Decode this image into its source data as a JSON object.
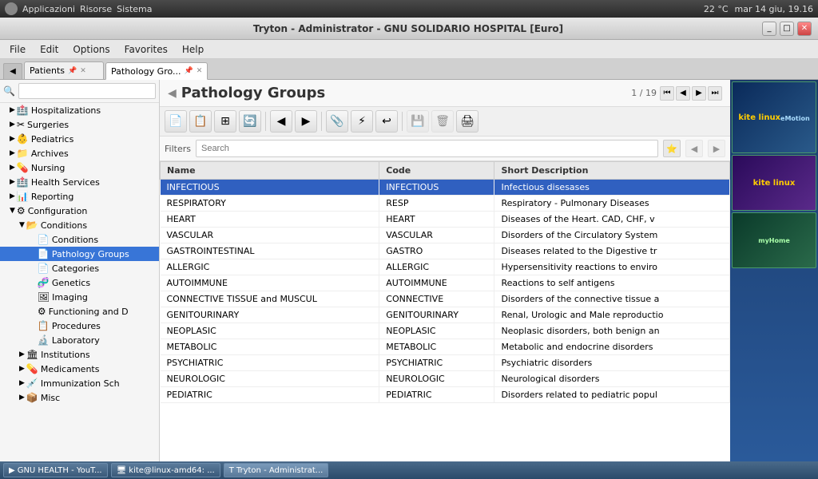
{
  "topbar": {
    "menu_items": [
      "Applicazioni",
      "Risorse",
      "Sistema"
    ],
    "time": "mar 14 giu, 19.16",
    "temp": "22 °C"
  },
  "titlebar": {
    "title": "Tryton - Administrator - GNU SOLIDARIO HOSPITAL [Euro]"
  },
  "menubar": {
    "items": [
      "File",
      "Edit",
      "Options",
      "Favorites",
      "Help"
    ]
  },
  "tabs": [
    {
      "label": "Patients",
      "active": false
    },
    {
      "label": "Pathology Gro...",
      "active": true
    }
  ],
  "page": {
    "title": "Pathology Groups",
    "counter": "1 / 19"
  },
  "filters": {
    "label": "Filters",
    "placeholder": "Search"
  },
  "table": {
    "columns": [
      "Name",
      "Code",
      "Short Description"
    ],
    "rows": [
      {
        "name": "INFECTIOUS",
        "code": "INFECTIOUS",
        "desc": "Infectious disesases",
        "selected": true
      },
      {
        "name": "RESPIRATORY",
        "code": "RESP",
        "desc": "Respiratory - Pulmonary Diseases"
      },
      {
        "name": "HEART",
        "code": "HEART",
        "desc": "Diseases of the Heart. CAD, CHF, v"
      },
      {
        "name": "VASCULAR",
        "code": "VASCULAR",
        "desc": "Disorders of the Circulatory System"
      },
      {
        "name": "GASTROINTESTINAL",
        "code": "GASTRO",
        "desc": "Diseases related to the Digestive tr"
      },
      {
        "name": "ALLERGIC",
        "code": "ALLERGIC",
        "desc": "Hypersensitivity reactions to enviro"
      },
      {
        "name": "AUTOIMMUNE",
        "code": "AUTOIMMUNE",
        "desc": "Reactions to self antigens"
      },
      {
        "name": "CONNECTIVE TISSUE and MUSCUL",
        "code": "CONNECTIVE",
        "desc": "Disorders of the connective tissue a"
      },
      {
        "name": "GENITOURINARY",
        "code": "GENITOURINARY",
        "desc": "Renal, Urologic and Male reproductio"
      },
      {
        "name": "NEOPLASIC",
        "code": "NEOPLASIC",
        "desc": "Neoplasic disorders, both benign an"
      },
      {
        "name": "METABOLIC",
        "code": "METABOLIC",
        "desc": "Metabolic and endocrine disorders"
      },
      {
        "name": "PSYCHIATRIC",
        "code": "PSYCHIATRIC",
        "desc": "Psychiatric disorders"
      },
      {
        "name": "NEUROLOGIC",
        "code": "NEUROLOGIC",
        "desc": "Neurological disorders"
      },
      {
        "name": "PEDIATRIC",
        "code": "PEDIATRIC",
        "desc": "Disorders related to pediatric popul"
      }
    ]
  },
  "sidebar": {
    "items": [
      {
        "label": "Hospitalizations",
        "level": 1,
        "expanded": false,
        "icon": "🏥"
      },
      {
        "label": "Surgeries",
        "level": 1,
        "expanded": false,
        "icon": "✂"
      },
      {
        "label": "Pediatrics",
        "level": 1,
        "expanded": false,
        "icon": "👶"
      },
      {
        "label": "Archives",
        "level": 1,
        "expanded": false,
        "icon": "📁"
      },
      {
        "label": "Nursing",
        "level": 1,
        "expanded": false,
        "icon": "💊"
      },
      {
        "label": "Health Services",
        "level": 1,
        "expanded": false,
        "icon": "🏥"
      },
      {
        "label": "Reporting",
        "level": 1,
        "expanded": false,
        "icon": "📊"
      },
      {
        "label": "Configuration",
        "level": 1,
        "expanded": true,
        "icon": "⚙"
      },
      {
        "label": "Conditions",
        "level": 2,
        "expanded": true,
        "icon": "📂"
      },
      {
        "label": "Conditions",
        "level": 3,
        "expanded": false,
        "icon": "📄"
      },
      {
        "label": "Pathology Groups",
        "level": 3,
        "expanded": false,
        "icon": "📄",
        "selected": true
      },
      {
        "label": "Categories",
        "level": 3,
        "expanded": false,
        "icon": "📄"
      },
      {
        "label": "Genetics",
        "level": 3,
        "expanded": false,
        "icon": "🧬"
      },
      {
        "label": "Imaging",
        "level": 3,
        "expanded": false,
        "icon": "🖼"
      },
      {
        "label": "Functioning and D",
        "level": 3,
        "expanded": false,
        "icon": "⚙"
      },
      {
        "label": "Procedures",
        "level": 3,
        "expanded": false,
        "icon": "📋"
      },
      {
        "label": "Laboratory",
        "level": 3,
        "expanded": false,
        "icon": "🔬"
      },
      {
        "label": "Institutions",
        "level": 2,
        "expanded": false,
        "icon": "🏛"
      },
      {
        "label": "Medicaments",
        "level": 2,
        "expanded": false,
        "icon": "💊"
      },
      {
        "label": "Immunization Sch",
        "level": 2,
        "expanded": false,
        "icon": "💉"
      },
      {
        "label": "Misc",
        "level": 2,
        "expanded": false,
        "icon": "📦"
      }
    ]
  },
  "statusbar": {
    "url": "tryton://health.gnusolidario.org:8000/health30/model/gnuhealth.pathology.group;context=%7B%22date_form"
  },
  "taskbar": {
    "items": [
      {
        "label": "GNU HEALTH - YouT...",
        "icon": "▶"
      },
      {
        "label": "kite@linux-amd64: ...",
        "icon": "🖥"
      },
      {
        "label": "Tryton - Administrat...",
        "icon": "T",
        "active": true
      }
    ]
  }
}
